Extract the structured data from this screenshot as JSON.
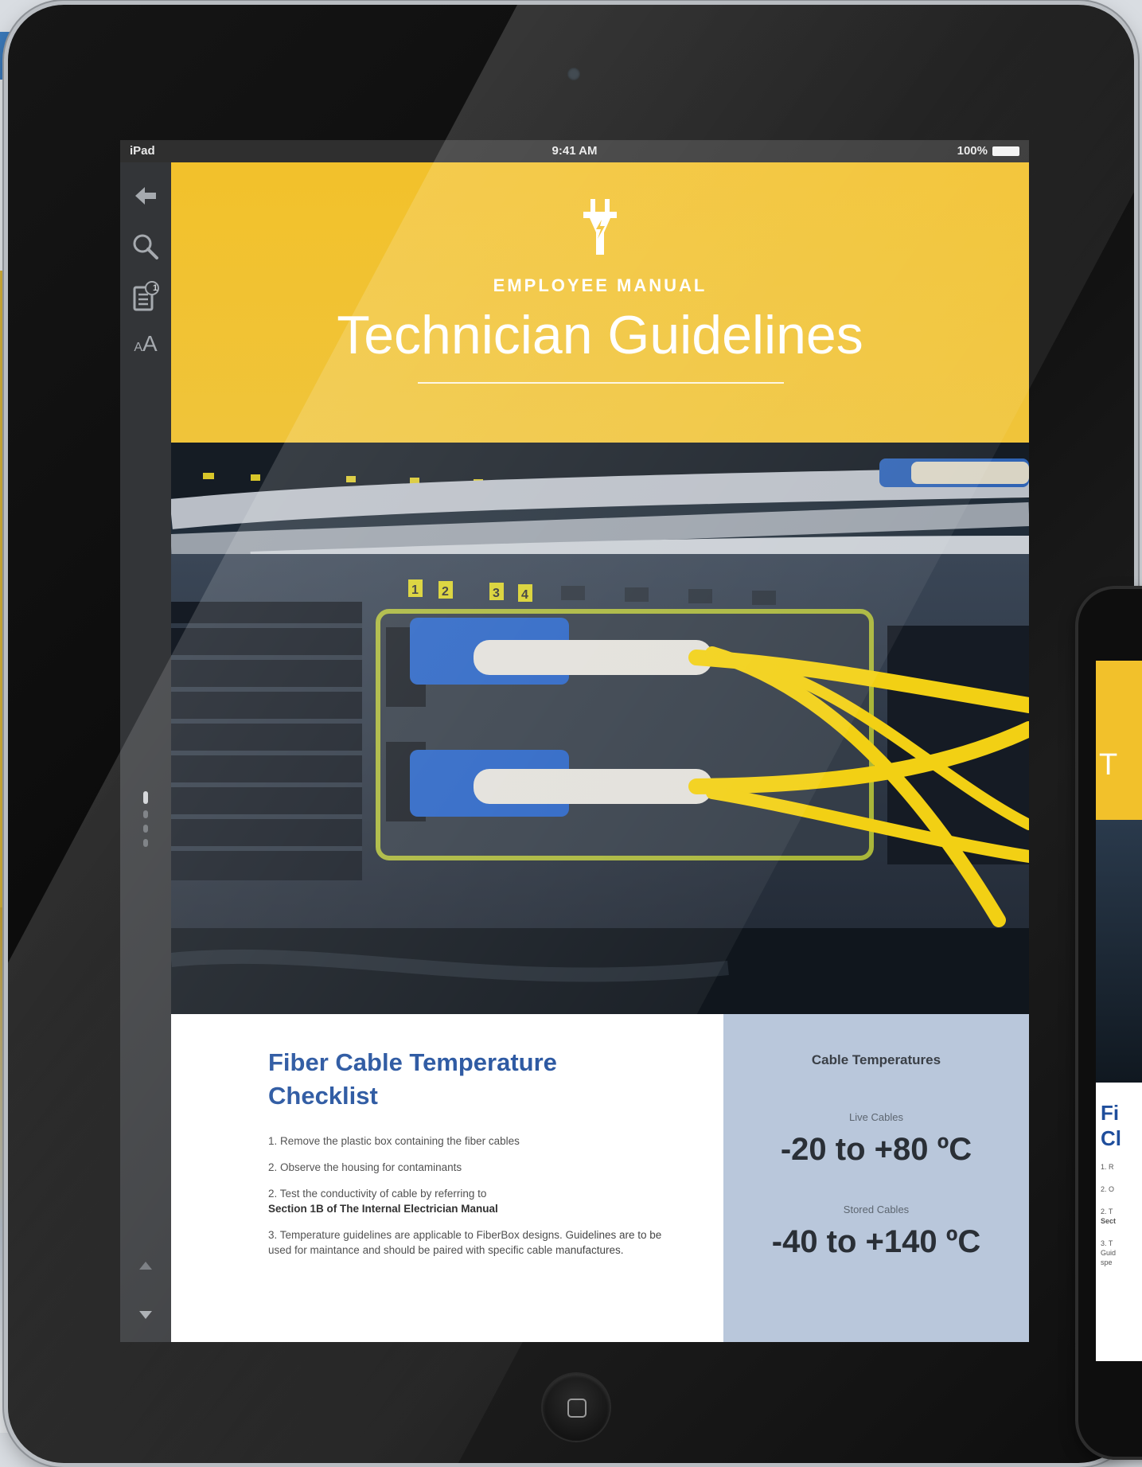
{
  "status_bar": {
    "device": "iPad",
    "time": "9:41 AM",
    "battery": "100%"
  },
  "sidebar": {
    "items": [
      {
        "name": "back",
        "icon": "arrow-left-icon"
      },
      {
        "name": "search",
        "icon": "search-icon"
      },
      {
        "name": "notes",
        "icon": "notes-icon",
        "badge": "1"
      },
      {
        "name": "text-size",
        "icon": "text-size-icon",
        "label_small": "A",
        "label_large": "A"
      },
      {
        "name": "page-up",
        "icon": "triangle-up-icon"
      },
      {
        "name": "page-down",
        "icon": "triangle-down-icon"
      }
    ],
    "page_count": 4,
    "current_page": 1
  },
  "hero": {
    "icon": "plug-icon",
    "eyebrow": "EMPLOYEE MANUAL",
    "title": "Technician Guidelines",
    "background": "#f2c12b"
  },
  "photo": {
    "port_labels": [
      "1",
      "2",
      "3",
      "4"
    ]
  },
  "checklist": {
    "title": "Fiber Cable Temperature Checklist",
    "items": [
      "1. Remove the plastic box containing the fiber cables",
      "2. Observe the housing for contaminants",
      "2. Test the conductivity of cable by referring to",
      "Section 1B of The Internal Electrician Manual",
      "3. Temperature guidelines are applicable to FiberBox designs. Guidelines are to be used for maintance and should be paired with specific cable manufactures."
    ],
    "title_color": "#1f4e9c"
  },
  "temperatures": {
    "heading": "Cable Temperatures",
    "live_label": "Live Cables",
    "live_value": "-20 to +80 ºC",
    "stored_label": "Stored Cables",
    "stored_value": "-40 to +140 ºC",
    "background": "#b9c7db"
  },
  "phone": {
    "title_fragment": "T",
    "checklist_fragment": [
      "Fi",
      "Cl"
    ],
    "list_fragments": [
      "1. R",
      "2. O",
      "2. T",
      "Sect",
      "3. T",
      "Guid",
      "spe"
    ]
  }
}
